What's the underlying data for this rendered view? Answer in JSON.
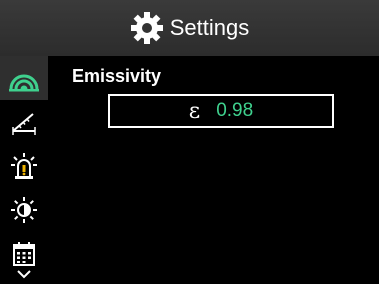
{
  "header": {
    "title": "Settings",
    "icon": "gear-icon"
  },
  "sidebar": {
    "items": [
      {
        "icon": "emissivity-icon",
        "active": true
      },
      {
        "icon": "distance-icon",
        "active": false
      },
      {
        "icon": "alarm-icon",
        "active": false
      },
      {
        "icon": "brightness-icon",
        "active": false
      },
      {
        "icon": "calendar-icon",
        "active": false
      },
      {
        "icon": "chevron-down-icon",
        "active": false
      }
    ]
  },
  "emissivity": {
    "label": "Emissivity",
    "symbol": "ε",
    "value": "0.98"
  },
  "colors": {
    "accent_green": "#3fd18e",
    "header_bg": "#333333",
    "active_item_bg": "#2f2f2f"
  }
}
